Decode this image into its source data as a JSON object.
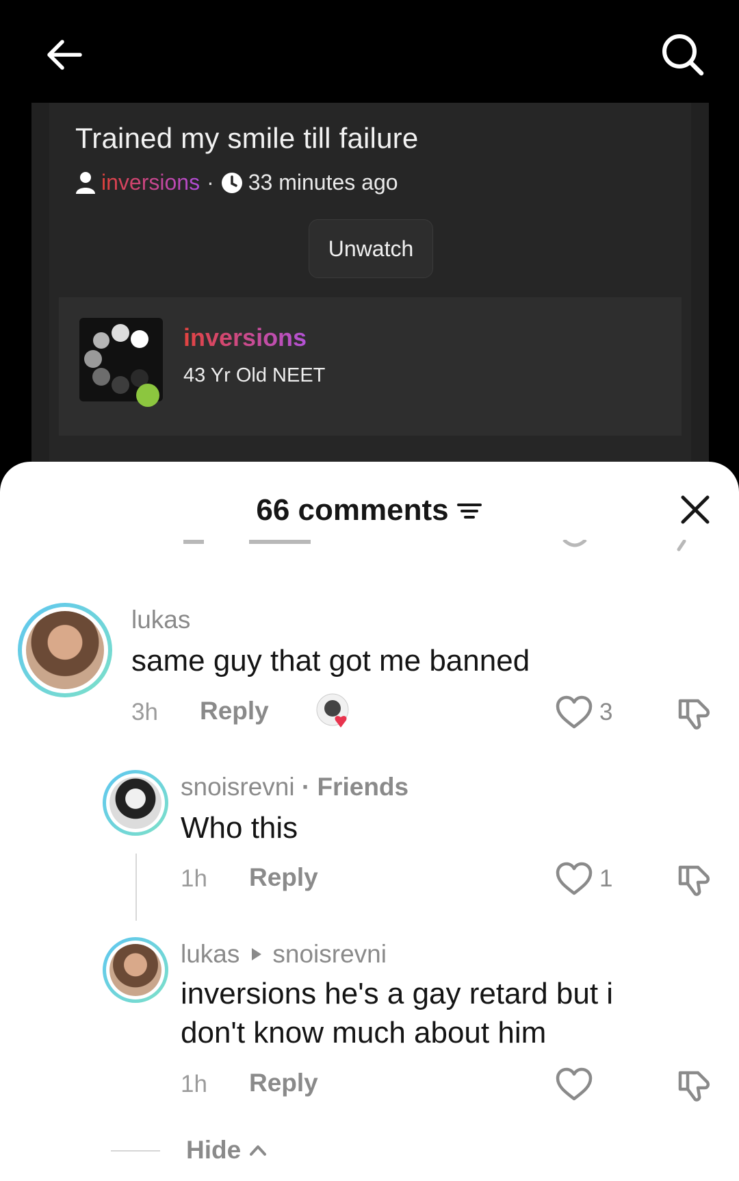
{
  "top_bar": {
    "back_icon": "arrow-left-icon",
    "search_icon": "search-icon"
  },
  "post": {
    "title": "Trained my smile till failure",
    "author": "inversions",
    "time": "33 minutes ago",
    "unwatch_label": "Unwatch",
    "profile": {
      "name": "inversions",
      "subtitle": "43 Yr Old NEET"
    }
  },
  "comments_sheet": {
    "title": "66 comments",
    "comments": [
      {
        "username": "lukas",
        "text": "same guy that got me banned",
        "time": "3h",
        "reply_label": "Reply",
        "likes": "3"
      }
    ],
    "replies": [
      {
        "username": "snoisrevni",
        "tag": "· Friends",
        "text": "Who this",
        "time": "1h",
        "reply_label": "Reply",
        "likes": "1"
      },
      {
        "username": "lukas",
        "reply_to": "snoisrevni",
        "text": "inversions he's a gay retard but i don't know much about him",
        "time": "1h",
        "reply_label": "Reply",
        "likes": ""
      }
    ],
    "hide_label": "Hide"
  },
  "colors": {
    "accent_gradient_start": "#e0413a",
    "accent_gradient_end": "#b04bd9",
    "avatar_ring_start": "#5ec6f0",
    "avatar_ring_end": "#7de0c8",
    "heart_red": "#e8344e"
  }
}
